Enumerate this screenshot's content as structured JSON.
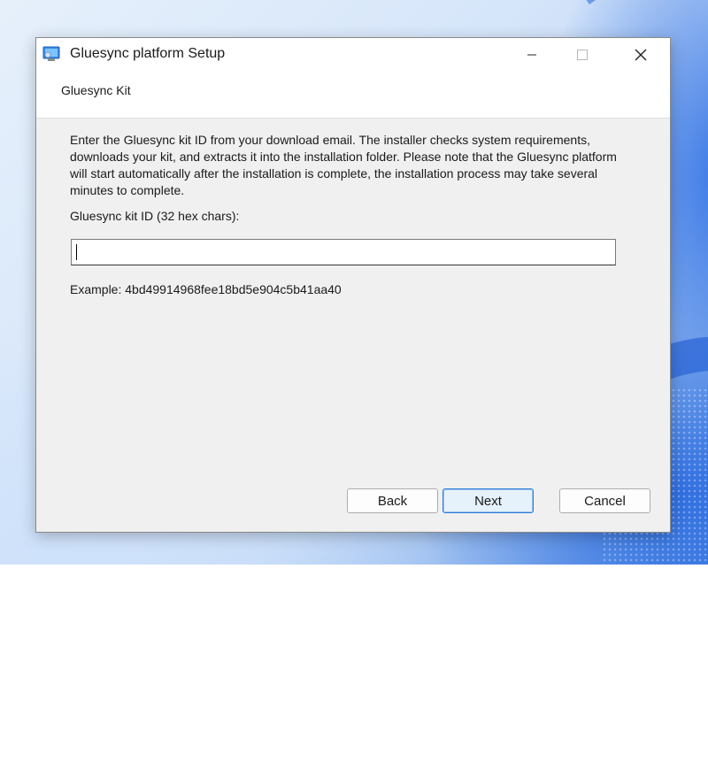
{
  "window": {
    "title": "Gluesync platform Setup",
    "icon": "installer-icon",
    "controls": {
      "minimize": "minimize-icon",
      "maximize": "maximize-icon",
      "close": "close-icon"
    }
  },
  "header": {
    "title": "Gluesync Kit"
  },
  "content": {
    "description": "Enter the Gluesync kit ID from your download email. The installer checks system requirements, downloads your kit, and extracts it into the installation folder. Please note that the Gluesync platform will start automatically after the installation is complete, the installation process may take several minutes to complete.",
    "field_label": "Gluesync kit ID (32 hex chars):",
    "field_value": "",
    "example": "Example: 4bd49914968fee18bd5e904c5b41aa40"
  },
  "buttons": {
    "back": "Back",
    "next": "Next",
    "cancel": "Cancel"
  },
  "colors": {
    "accent": "#2b7bd8",
    "window_bg": "#f0f0f0"
  }
}
